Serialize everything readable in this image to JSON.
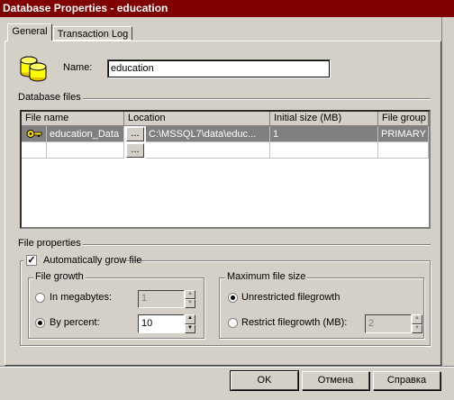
{
  "window": {
    "title": "Database Properties - education"
  },
  "tabs": [
    {
      "label": "General",
      "active": true
    },
    {
      "label": "Transaction Log",
      "active": false
    }
  ],
  "name_field": {
    "label": "Name:",
    "value": "education"
  },
  "database_files": {
    "section_label": "Database files",
    "columns": [
      "File name",
      "Location",
      "Initial size (MB)",
      "File group"
    ],
    "rows": [
      {
        "file_name": "education_Data",
        "browse": "...",
        "location": "C:\\MSSQL7\\data\\educ...",
        "initial_size": "1",
        "file_group": "PRIMARY",
        "selected": true
      },
      {
        "file_name": "",
        "browse": "...",
        "location": "",
        "initial_size": "",
        "file_group": "",
        "selected": false
      }
    ]
  },
  "file_properties": {
    "section_label": "File properties",
    "auto_grow": {
      "label": "Automatically grow file",
      "checked": true
    },
    "file_growth": {
      "label": "File growth",
      "in_megabytes": {
        "label": "In megabytes:",
        "value": "1",
        "selected": false
      },
      "by_percent": {
        "label": "By percent:",
        "value": "10",
        "selected": true
      }
    },
    "max_size": {
      "label": "Maximum file size",
      "unrestricted": {
        "label": "Unrestricted filegrowth",
        "selected": true
      },
      "restrict": {
        "label": "Restrict filegrowth (MB):",
        "value": "2",
        "selected": false
      }
    }
  },
  "buttons": {
    "ok": "OK",
    "cancel": "Отмена",
    "help": "Справка"
  },
  "colors": {
    "titlebar": "#800000",
    "face": "#d4d0c8",
    "selected_row": "#808080"
  }
}
